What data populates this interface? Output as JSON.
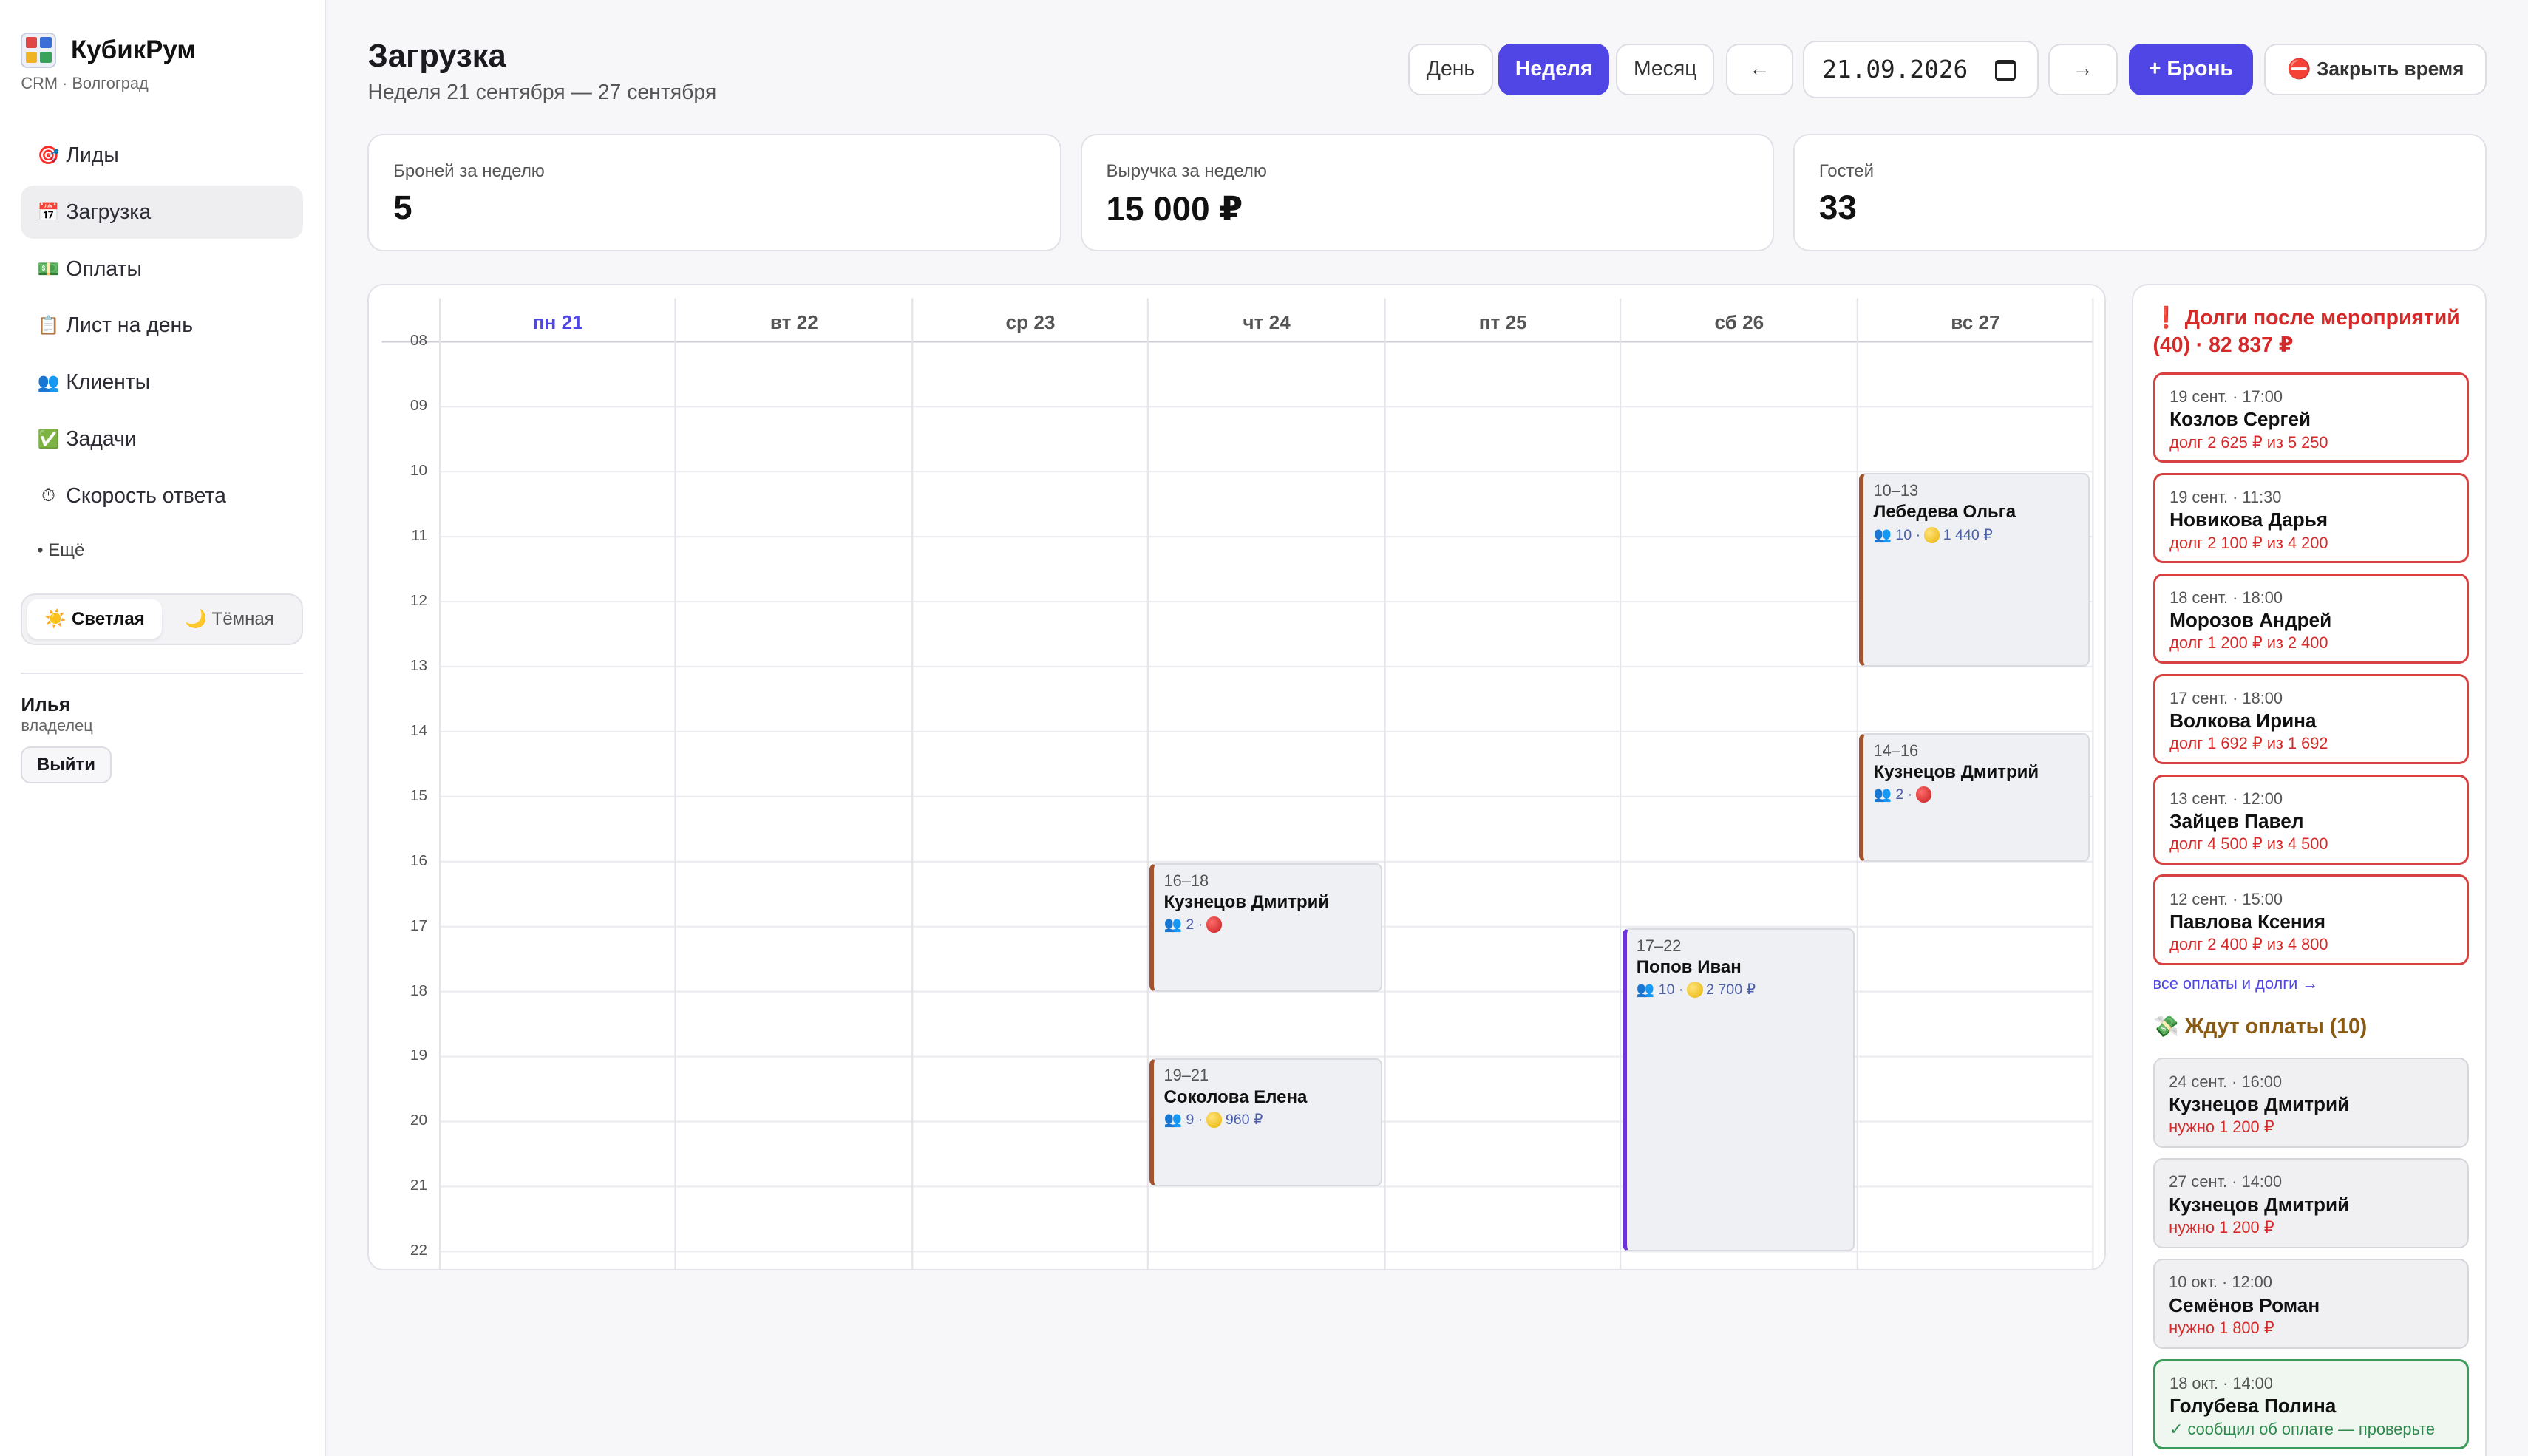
{
  "brand": {
    "title": "КубикРум",
    "subtitle": "CRM · Волгоград"
  },
  "nav": [
    {
      "icon": "🎯",
      "label": "Лиды",
      "active": false
    },
    {
      "icon": "📅",
      "label": "Загрузка",
      "active": true
    },
    {
      "icon": "💵",
      "label": "Оплаты",
      "active": false
    },
    {
      "icon": "📋",
      "label": "Лист на день",
      "active": false
    },
    {
      "icon": "👥",
      "label": "Клиенты",
      "active": false
    },
    {
      "icon": "✅",
      "label": "Задачи",
      "active": false
    },
    {
      "icon": "⏱",
      "label": "Скорость ответа",
      "active": false
    }
  ],
  "nav_more": "• Ещё",
  "theme": {
    "light": "☀️ Светлая",
    "dark": "🌙 Тёмная"
  },
  "user": {
    "name": "Илья",
    "role": "владелец",
    "logout": "Выйти"
  },
  "header": {
    "title": "Загрузка",
    "subtitle": "Неделя 21 сентября — 27 сентября"
  },
  "toolbar": {
    "day": "День",
    "week": "Неделя",
    "month": "Месяц",
    "prev": "←",
    "date": "21.09.2026",
    "next": "→",
    "new_booking": "+ Бронь",
    "close_time": "⛔ Закрыть время"
  },
  "stats": [
    {
      "label": "Броней за неделю",
      "value": "5"
    },
    {
      "label": "Выручка за неделю",
      "value": "15 000 ₽"
    },
    {
      "label": "Гостей",
      "value": "33"
    }
  ],
  "calendar": {
    "days": [
      "пн 21",
      "вт 22",
      "ср 23",
      "чт 24",
      "пт 25",
      "сб 26",
      "вс 27"
    ],
    "today_index": 0,
    "hours": [
      "08",
      "09",
      "10",
      "11",
      "12",
      "13",
      "14",
      "15",
      "16",
      "17",
      "18",
      "19",
      "20",
      "21",
      "22"
    ],
    "events": [
      {
        "day": 6,
        "start": 10,
        "end": 13,
        "time": "10–13",
        "name": "Лебедева Ольга",
        "guests": "👥 10 ·",
        "status": "yellow",
        "amount": "1 440 ₽",
        "color": "brown"
      },
      {
        "day": 6,
        "start": 14,
        "end": 16,
        "time": "14–16",
        "name": "Кузнецов Дмитрий",
        "guests": "👥 2 ·",
        "status": "red",
        "amount": "",
        "color": "brown"
      },
      {
        "day": 3,
        "start": 16,
        "end": 18,
        "time": "16–18",
        "name": "Кузнецов Дмитрий",
        "guests": "👥 2 ·",
        "status": "red",
        "amount": "",
        "color": "brown"
      },
      {
        "day": 3,
        "start": 19,
        "end": 21,
        "time": "19–21",
        "name": "Соколова Елена",
        "guests": "👥 9 ·",
        "status": "yellow",
        "amount": "960 ₽",
        "color": "brown"
      },
      {
        "day": 5,
        "start": 17,
        "end": 22,
        "time": "17–22",
        "name": "Попов Иван",
        "guests": "👥 10 ·",
        "status": "yellow",
        "amount": "2 700 ₽",
        "color": "purple"
      }
    ]
  },
  "panel": {
    "debts_title": "❗ Долги после мероприятий (40) · 82 837 ₽",
    "debts": [
      {
        "date": "19 сент. · 17:00",
        "name": "Козлов Сергей",
        "note": "долг 2 625 ₽ из 5 250"
      },
      {
        "date": "19 сент. · 11:30",
        "name": "Новикова Дарья",
        "note": "долг 2 100 ₽ из 4 200"
      },
      {
        "date": "18 сент. · 18:00",
        "name": "Морозов Андрей",
        "note": "долг 1 200 ₽ из 2 400"
      },
      {
        "date": "17 сент. · 18:00",
        "name": "Волкова Ирина",
        "note": "долг 1 692 ₽ из 1 692"
      },
      {
        "date": "13 сент. · 12:00",
        "name": "Зайцев Павел",
        "note": "долг 4 500 ₽ из 4 500"
      },
      {
        "date": "12 сент. · 15:00",
        "name": "Павлова Ксения",
        "note": "долг 2 400 ₽ из 4 800"
      }
    ],
    "all_link": "все оплаты и долги →",
    "waiting_title": "💸 Ждут оплаты (10)",
    "waiting": [
      {
        "date": "24 сент. · 16:00",
        "name": "Кузнецов Дмитрий",
        "note": "нужно 1 200 ₽",
        "ok": false
      },
      {
        "date": "27 сент. · 14:00",
        "name": "Кузнецов Дмитрий",
        "note": "нужно 1 200 ₽",
        "ok": false
      },
      {
        "date": "10 окт. · 12:00",
        "name": "Семёнов Роман",
        "note": "нужно 1 800 ₽",
        "ok": false
      },
      {
        "date": "18 окт. · 14:00",
        "name": "Голубева Полина",
        "note": "✓ сообщил об оплате — проверьте",
        "ok": true
      }
    ]
  }
}
